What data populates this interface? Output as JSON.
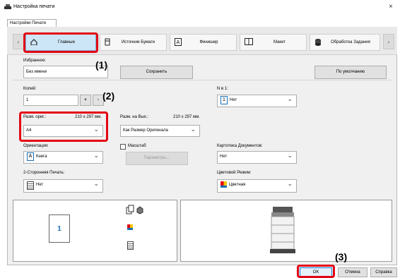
{
  "window": {
    "title": "Настройка печати",
    "close": "×"
  },
  "tab": "Настройки Печати",
  "ribbon": {
    "prev": "‹",
    "next": "›",
    "tabs": [
      {
        "label": "Главные",
        "icon": "home-icon"
      },
      {
        "label": "Источник Бумаги",
        "icon": "paper-source-icon"
      },
      {
        "label": "Финишер",
        "icon": "finisher-icon"
      },
      {
        "label": "Макет",
        "icon": "layout-icon"
      },
      {
        "label": "Обработка Задания",
        "icon": "job-handling-icon"
      }
    ]
  },
  "callouts": {
    "c1": "(1)",
    "c2": "(2)",
    "c3": "(3)"
  },
  "favorites": {
    "label": "Избранное:",
    "value": "Без имени",
    "save": "Сохранить",
    "default": "По умолчанию"
  },
  "copies": {
    "label": "Копий:",
    "value": "1",
    "plus": "+",
    "minus": "-"
  },
  "n_up": {
    "label": "N в 1:",
    "value": "Нет",
    "icon_num": "1"
  },
  "original_size": {
    "label": "Разм. ориг.:",
    "dims": "210 x 297 мм.",
    "value": "A4"
  },
  "output_size": {
    "label": "Разм. на Вых.:",
    "dims": "210 x 297 мм.",
    "value": "Как Размер Оригинала"
  },
  "orientation": {
    "label": "Ориентация:",
    "value": "Книга",
    "icon_letter": "A"
  },
  "scale": {
    "label": "Масштаб",
    "params": "Параметры..."
  },
  "doc_filing": {
    "label": "Картотека Документов:",
    "value": "Нет"
  },
  "duplex": {
    "label": "2-Сторонняя Печать:",
    "value": "Нет"
  },
  "color_mode": {
    "label": "Цветовой Режим:",
    "value": "Цветная"
  },
  "preview": {
    "page_number": "1"
  },
  "buttons": {
    "ok": "OK",
    "cancel": "Отмена",
    "help": "Справка"
  },
  "colors": {
    "highlight": "#e30613",
    "accent_blue": "#1a6fb3"
  }
}
